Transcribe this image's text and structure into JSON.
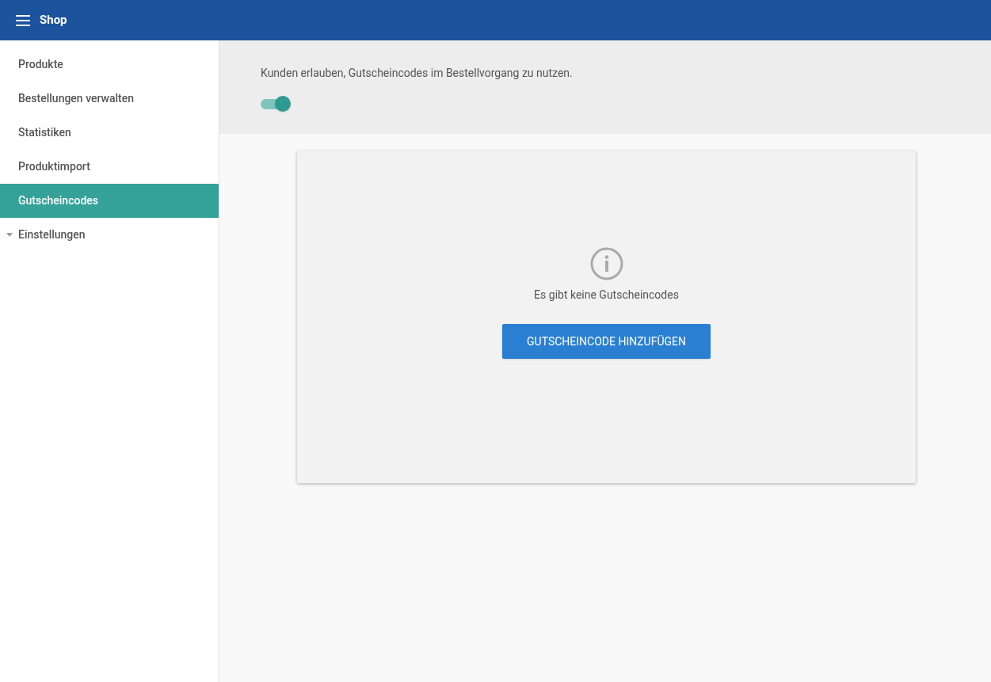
{
  "header": {
    "title": "Shop"
  },
  "sidebar": {
    "items": [
      {
        "label": "Produkte",
        "kind": "link",
        "selected": false
      },
      {
        "label": "Bestellungen verwalten",
        "kind": "link",
        "selected": false
      },
      {
        "label": "Statistiken",
        "kind": "link",
        "selected": false
      },
      {
        "label": "Produktimport",
        "kind": "link",
        "selected": false
      },
      {
        "label": "Gutscheincodes",
        "kind": "link",
        "selected": true
      },
      {
        "label": "Einstellungen",
        "kind": "group",
        "selected": false
      }
    ]
  },
  "setting": {
    "label": "Kunden erlauben, Gutscheincodes im Bestellvorgang zu nutzen.",
    "on": true
  },
  "empty_state": {
    "message": "Es gibt keine Gutscheincodes",
    "button": "GUTSCHEINCODE HINZUFÜGEN"
  }
}
